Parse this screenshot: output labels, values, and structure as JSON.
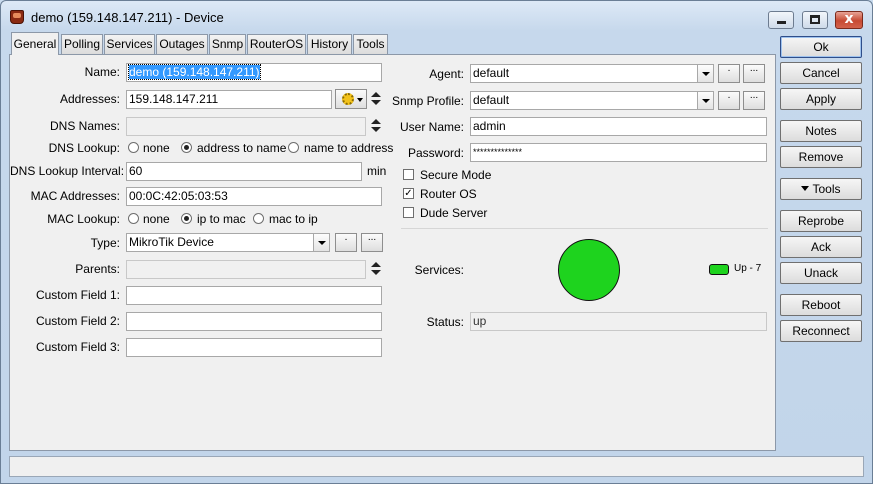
{
  "window": {
    "title": "demo (159.148.147.211) - Device",
    "close_glyph": "x"
  },
  "tabs": [
    {
      "label": "General",
      "active": true
    },
    {
      "label": "Polling"
    },
    {
      "label": "Services"
    },
    {
      "label": "Outages"
    },
    {
      "label": "Snmp"
    },
    {
      "label": "RouterOS"
    },
    {
      "label": "History"
    },
    {
      "label": "Tools"
    }
  ],
  "left": {
    "name_label": "Name:",
    "name_value": "demo (159.148.147.211)",
    "addresses_label": "Addresses:",
    "addresses_value": "159.148.147.211",
    "dns_names_label": "DNS Names:",
    "dns_names_value": "",
    "dns_lookup_label": "DNS Lookup:",
    "dns_lookup_options": [
      "none",
      "address to name",
      "name to address"
    ],
    "dns_lookup_selected": "address to name",
    "dns_interval_label": "DNS Lookup Interval:",
    "dns_interval_value": "60",
    "dns_interval_unit": "min",
    "mac_addresses_label": "MAC Addresses:",
    "mac_addresses_value": "00:0C:42:05:03:53",
    "mac_lookup_label": "MAC Lookup:",
    "mac_lookup_options": [
      "none",
      "ip to mac",
      "mac to ip"
    ],
    "mac_lookup_selected": "ip to mac",
    "type_label": "Type:",
    "type_value": "MikroTik Device",
    "parents_label": "Parents:",
    "parents_value": "",
    "custom1_label": "Custom Field 1:",
    "custom1_value": "",
    "custom2_label": "Custom Field 2:",
    "custom2_value": "",
    "custom3_label": "Custom Field 3:",
    "custom3_value": ""
  },
  "right": {
    "agent_label": "Agent:",
    "agent_value": "default",
    "snmp_label": "Snmp Profile:",
    "snmp_value": "default",
    "user_label": "User Name:",
    "user_value": "admin",
    "password_label": "Password:",
    "password_value": "**************",
    "secure_mode_label": "Secure Mode",
    "secure_mode_checked": false,
    "router_os_label": "Router OS",
    "router_os_checked": true,
    "dude_server_label": "Dude Server",
    "dude_server_checked": false,
    "services_label": "Services:",
    "services_legend": "Up  -  7",
    "status_label": "Status:",
    "status_value": "up",
    "small_btn_dot": ".",
    "small_btn_dots": "..."
  },
  "buttons": {
    "ok": "Ok",
    "cancel": "Cancel",
    "apply": "Apply",
    "notes": "Notes",
    "remove": "Remove",
    "tools": "Tools",
    "reprobe": "Reprobe",
    "ack": "Ack",
    "unack": "Unack",
    "reboot": "Reboot",
    "reconnect": "Reconnect"
  },
  "colors": {
    "service_up": "#1ed31e",
    "selection": "#3399ff"
  },
  "statusbar": {
    "text": ""
  }
}
